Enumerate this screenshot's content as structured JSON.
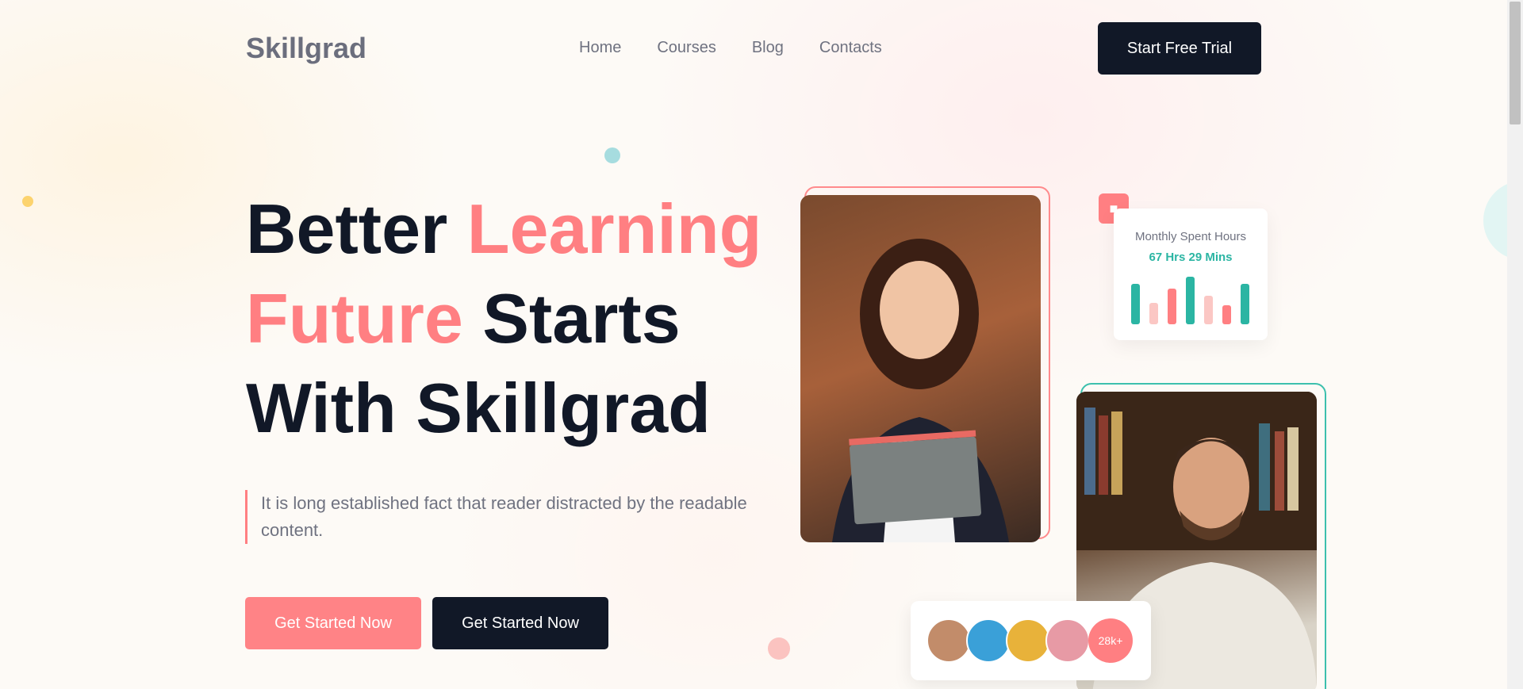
{
  "header": {
    "logo": "Skillgrad",
    "nav": [
      "Home",
      "Courses",
      "Blog",
      "Contacts"
    ],
    "cta": "Start Free Trial"
  },
  "hero": {
    "headline_line1_a": "Better ",
    "headline_line1_b": "Learning",
    "headline_line2_a": "Future",
    "headline_line2_b": " Starts",
    "headline_line3": "With Skillgrad",
    "lead": "It is long established fact that reader distracted by the readable content.",
    "buttons": [
      "Get Started Now",
      "Get Started Now"
    ]
  },
  "stats_card": {
    "title": "Monthly Spent Hours",
    "value": "67 Hrs 29 Mins",
    "icon": "bookmark-icon",
    "bars": [
      {
        "level": 0.85,
        "color": "#2bb5a3"
      },
      {
        "level": 0.45,
        "color": "#fbc7c4"
      },
      {
        "level": 0.75,
        "color": "#ff7f82"
      },
      {
        "level": 1.0,
        "color": "#2bb5a3"
      },
      {
        "level": 0.6,
        "color": "#fbc7c4"
      },
      {
        "level": 0.4,
        "color": "#ff7f82"
      },
      {
        "level": 0.85,
        "color": "#2bb5a3"
      }
    ]
  },
  "community": {
    "count": "28k+",
    "avatar_colors": [
      "#c28c6a",
      "#3aa0d8",
      "#e8b23a",
      "#e79aa5"
    ]
  },
  "colors": {
    "accent": "#ff7f82",
    "dark": "#111827",
    "teal": "#2bb5a3"
  }
}
